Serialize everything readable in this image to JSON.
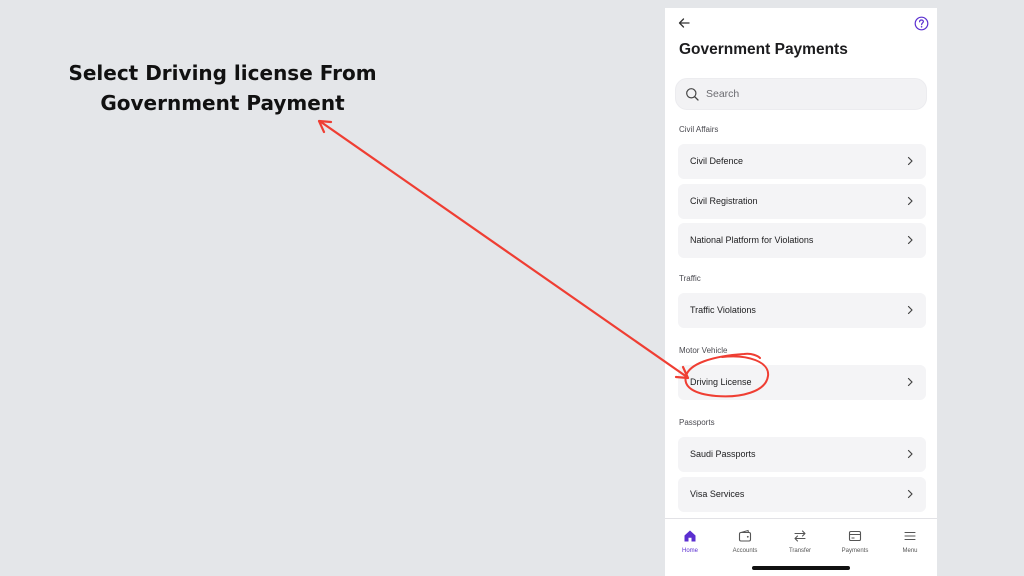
{
  "annotation": {
    "line1": "Select Driving license From",
    "line2": "Government Payment",
    "arrow_color": "#ef3e33"
  },
  "header": {
    "title": "Government Payments",
    "back_icon": "arrow-left-icon",
    "help_icon": "question-circle-icon"
  },
  "search": {
    "placeholder": "Search",
    "value": ""
  },
  "sections": [
    {
      "label": "Civil Affairs",
      "items": [
        "Civil Defence",
        "Civil Registration",
        "National Platform for Violations"
      ]
    },
    {
      "label": "Traffic",
      "items": [
        "Traffic Violations"
      ]
    },
    {
      "label": "Motor Vehicle",
      "items": [
        "Driving License"
      ]
    },
    {
      "label": "Passports",
      "items": [
        "Saudi Passports",
        "Visa Services"
      ]
    }
  ],
  "nav": {
    "active": "Home",
    "items": [
      {
        "label": "Home",
        "icon": "home-icon"
      },
      {
        "label": "Accounts",
        "icon": "wallet-icon"
      },
      {
        "label": "Transfer",
        "icon": "transfer-icon"
      },
      {
        "label": "Payments",
        "icon": "card-icon"
      },
      {
        "label": "Menu",
        "icon": "menu-icon"
      }
    ]
  },
  "colors": {
    "accent": "#5b2fd0",
    "background": "#e4e6e9",
    "item_background": "#f4f4f6"
  }
}
